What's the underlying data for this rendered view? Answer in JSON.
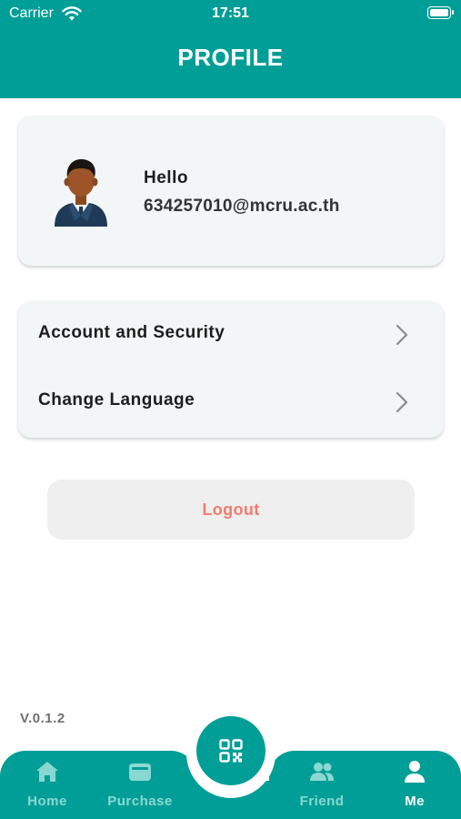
{
  "status_bar": {
    "carrier": "Carrier",
    "time": "17:51",
    "icons": [
      "wifi-icon",
      "battery-icon"
    ]
  },
  "header": {
    "title": "PROFILE"
  },
  "profile": {
    "greeting": "Hello",
    "email": "634257010@mcru.ac.th",
    "avatar": "person-avatar"
  },
  "menu": {
    "items": [
      {
        "label": "Account and Security",
        "icon": "chevron-right-icon"
      },
      {
        "label": "Change Language",
        "icon": "chevron-right-icon"
      }
    ]
  },
  "logout": {
    "label": "Logout"
  },
  "app": {
    "version": "V.0.1.2"
  },
  "tab_bar": {
    "center_icon": "qr-code-icon",
    "tabs": [
      {
        "label": "Home",
        "icon": "home-icon",
        "active": false
      },
      {
        "label": "Purchase",
        "icon": "wallet-icon",
        "active": false
      },
      {
        "label": "Friend",
        "icon": "friends-icon",
        "active": false
      },
      {
        "label": "Me",
        "icon": "person-icon",
        "active": true
      }
    ]
  },
  "colors": {
    "primary": "#009e96",
    "card_bg": "#f2f6f7",
    "logout_text": "#f27c70",
    "inactive_tab": "#8ad8d2"
  }
}
